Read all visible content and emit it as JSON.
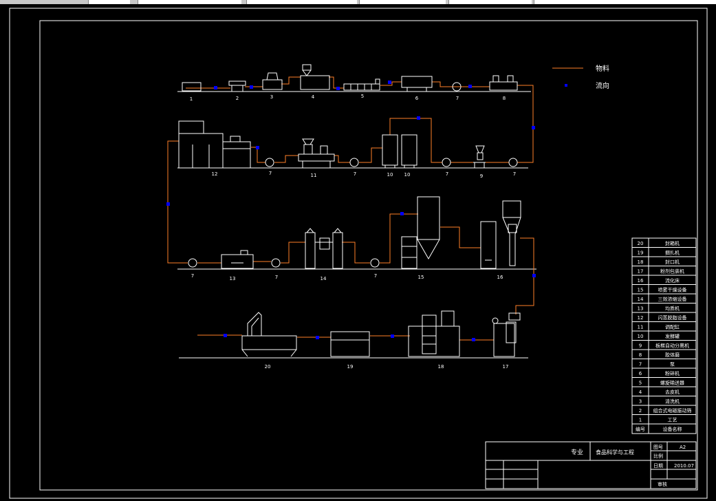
{
  "legend": {
    "material_label": "物料",
    "flow_label": "流向",
    "material_color": "#ff7f27",
    "flow_color": "#0000ff"
  },
  "colors": {
    "background": "#000000",
    "linework": "#ffffff",
    "pipe": "#ff7f27",
    "flow_marker": "#0000ff"
  },
  "equipment_numbers": {
    "row1": [
      "1",
      "2",
      "3",
      "4",
      "5",
      "6",
      "7",
      "8"
    ],
    "row2": [
      "12",
      "7",
      "11",
      "7",
      "10",
      "10",
      "7",
      "9",
      "7"
    ],
    "row3": [
      "7",
      "13",
      "7",
      "14",
      "7",
      "15",
      "16"
    ],
    "row4": [
      "20",
      "19",
      "18",
      "17"
    ]
  },
  "parts_list": {
    "header": {
      "no": "编号",
      "name": "设备名称"
    },
    "rows": [
      {
        "no": "20",
        "name": "封箱机"
      },
      {
        "no": "19",
        "name": "捆扎机"
      },
      {
        "no": "18",
        "name": "封口机"
      },
      {
        "no": "17",
        "name": "粉剂包装机"
      },
      {
        "no": "16",
        "name": "流化床"
      },
      {
        "no": "15",
        "name": "喷雾干燥设备"
      },
      {
        "no": "14",
        "name": "三效浓缩设备"
      },
      {
        "no": "13",
        "name": "均质机"
      },
      {
        "no": "12",
        "name": "闪蒸脱脂设备"
      },
      {
        "no": "11",
        "name": "调配缸"
      },
      {
        "no": "10",
        "name": "发酵罐"
      },
      {
        "no": "9",
        "name": "板框自动分离机"
      },
      {
        "no": "8",
        "name": "胶体磨"
      },
      {
        "no": "7",
        "name": "泵"
      },
      {
        "no": "6",
        "name": "粉碎机"
      },
      {
        "no": "5",
        "name": "螺旋输送器"
      },
      {
        "no": "4",
        "name": "去皮机"
      },
      {
        "no": "3",
        "name": "清洗机"
      },
      {
        "no": "2",
        "name": "组合式电磁振动筛"
      },
      {
        "no": "1",
        "name": "工艺"
      }
    ]
  },
  "title_block": {
    "major_label": "专业",
    "major_value": "食品科学与工程",
    "drawing_no_label": "图号",
    "drawing_no_value": "A2",
    "scale_label": "比例",
    "scale_value": "",
    "date_label": "日期",
    "date_value": "2010.07",
    "approved_label": "审核"
  }
}
